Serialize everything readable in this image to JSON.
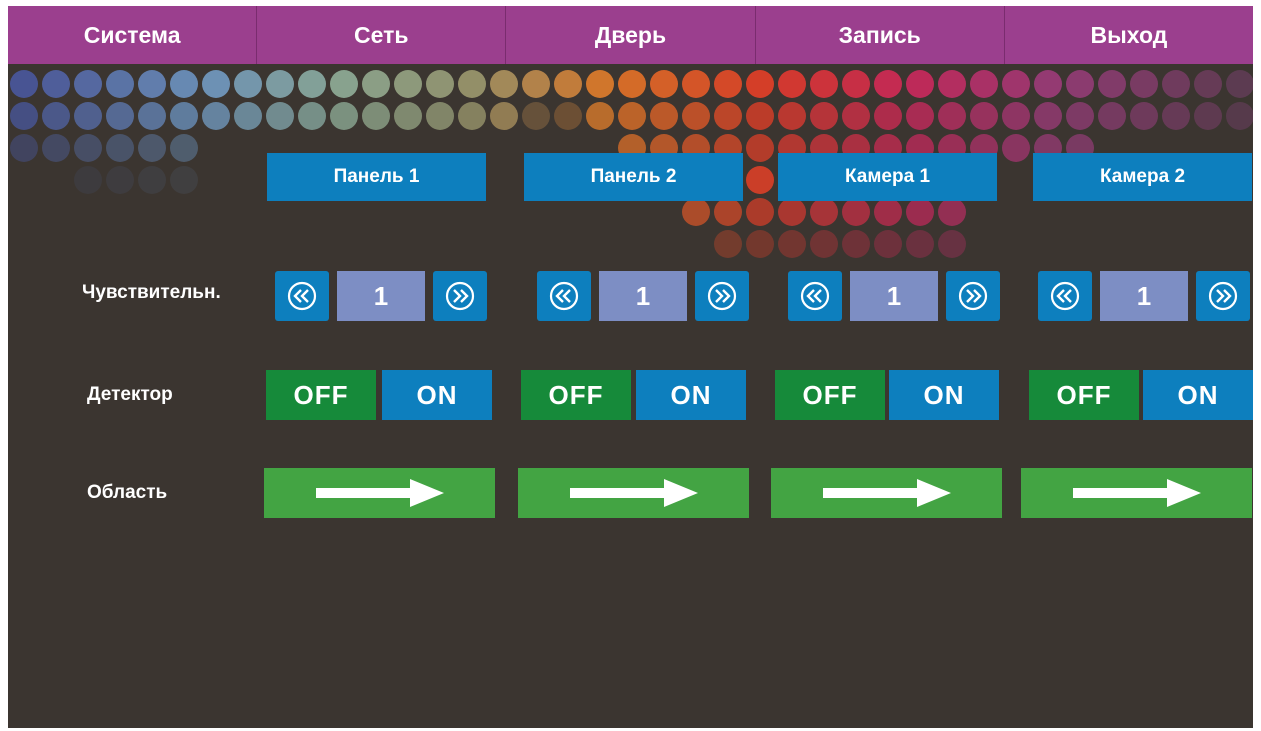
{
  "menu": [
    "Система",
    "Сеть",
    "Дверь",
    "Запись",
    "Выход"
  ],
  "colors": {
    "menu_bg": "#9b3f8e",
    "background": "#3b3530",
    "header_blue": "#0d7fbe",
    "value_bg": "#7d8ec4",
    "off_green": "#168a3a",
    "area_green": "#43a443"
  },
  "row_labels": {
    "sensitivity": "Чувствительн.",
    "detector": "Детектор",
    "area": "Область"
  },
  "columns": [
    {
      "title": "Панель 1",
      "sensitivity": "1",
      "off_label": "OFF",
      "on_label": "ON"
    },
    {
      "title": "Панель 2",
      "sensitivity": "1",
      "off_label": "OFF",
      "on_label": "ON"
    },
    {
      "title": "Камера 1",
      "sensitivity": "1",
      "off_label": "OFF",
      "on_label": "ON"
    },
    {
      "title": "Камера 2",
      "sensitivity": "1",
      "off_label": "OFF",
      "on_label": "ON"
    }
  ],
  "icons": {
    "decrease": "double-chevron-left-icon",
    "increase": "double-chevron-right-icon",
    "area": "arrow-right-icon"
  }
}
